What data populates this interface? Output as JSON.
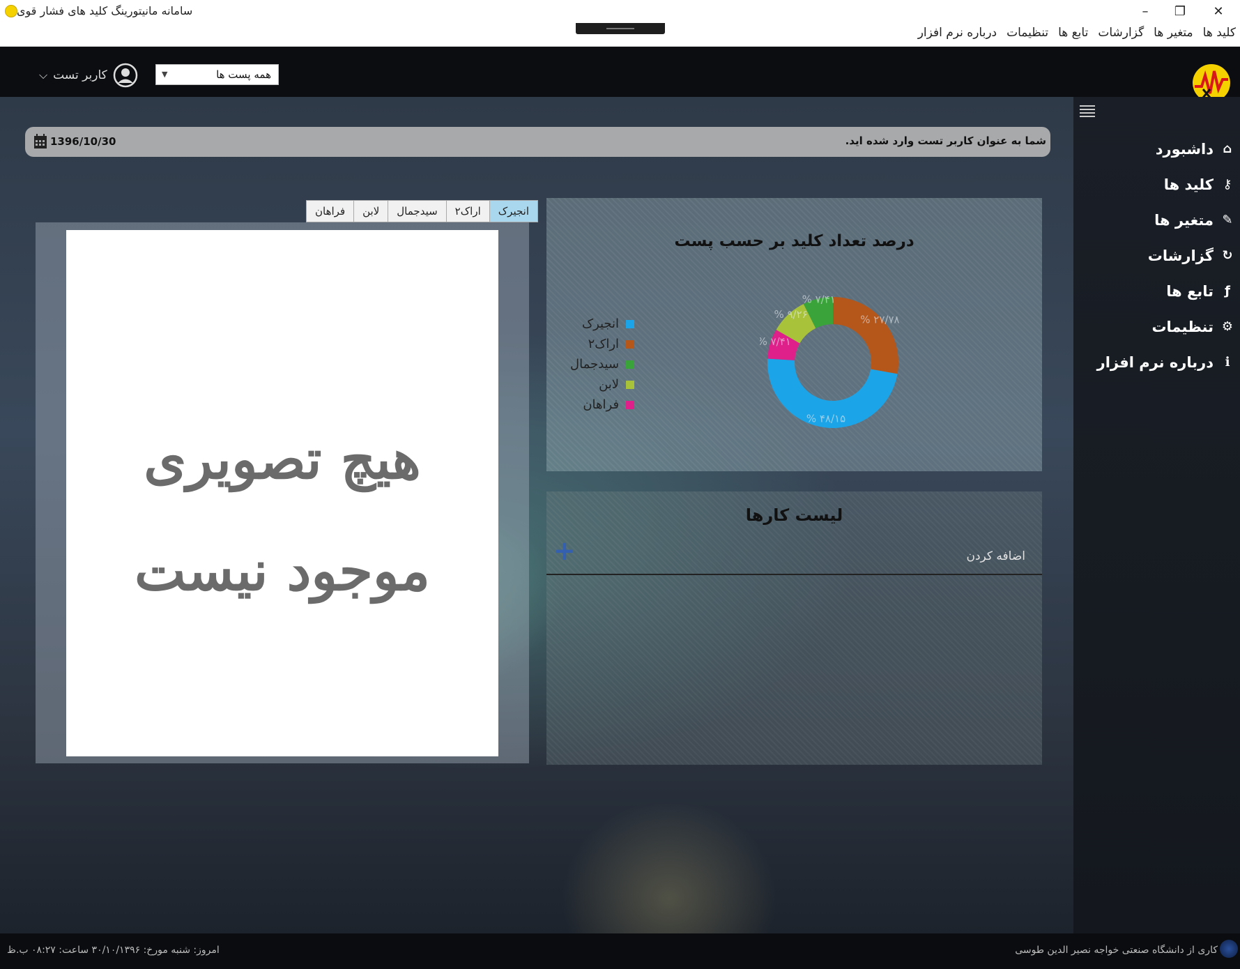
{
  "window": {
    "title": "سامانه مانیتورینگ کلید های فشار قوی",
    "minimize_glyph": "–",
    "maximize_glyph": "❐",
    "close_glyph": "✕"
  },
  "menu": {
    "items": [
      "کلید ها",
      "متغیر ها",
      "گزارشات",
      "تابع ها",
      "تنظیمات",
      "درباره نرم افزار"
    ]
  },
  "header": {
    "station_select": {
      "selected": "همه پست ها"
    },
    "user": {
      "name": "کاربر تست"
    }
  },
  "sidebar": {
    "items": [
      {
        "label": "داشبورد",
        "icon": "home-icon",
        "glyph": "⌂"
      },
      {
        "label": "کلید ها",
        "icon": "key-icon",
        "glyph": "⚷"
      },
      {
        "label": "متغیر ها",
        "icon": "variable-icon",
        "glyph": "✎"
      },
      {
        "label": "گزارشات",
        "icon": "report-icon",
        "glyph": "↻"
      },
      {
        "label": "تابع ها",
        "icon": "function-icon",
        "glyph": "ƒ"
      },
      {
        "label": "تنظیمات",
        "icon": "gear-icon",
        "glyph": "⚙"
      },
      {
        "label": "درباره نرم افزار",
        "icon": "info-icon",
        "glyph": "ℹ"
      }
    ]
  },
  "welcome": {
    "message": "شما به عنوان کاربر تست وارد شده اید.",
    "date": "1396/10/30"
  },
  "image_panel": {
    "tabs": [
      "انجیرک",
      "اراک۲",
      "سیدجمال",
      "لابن",
      "فراهان"
    ],
    "active_tab": 0,
    "no_image_line1": "هیچ تصویری",
    "no_image_line2": "موجود نیست"
  },
  "chart_data": {
    "type": "pie",
    "title": "درصد تعداد کلید بر حسب پست",
    "donut": true,
    "legend_position": "left",
    "series": [
      {
        "name": "انجیرک",
        "value": 48.15,
        "label": "% ۴۸/۱۵",
        "color": "#1ca4e8"
      },
      {
        "name": "اراک۲",
        "value": 27.78,
        "label": "% ۲۷/۷۸",
        "color": "#b5561a"
      },
      {
        "name": "سیدجمال",
        "value": 7.41,
        "label": "% ۷/۴۱",
        "color": "#3aa43a"
      },
      {
        "name": "لابن",
        "value": 9.26,
        "label": "% ۹/۲۶",
        "color": "#a8c23a"
      },
      {
        "name": "فراهان",
        "value": 7.41,
        "label": "% ۷/۴۱",
        "color": "#e0208a"
      }
    ]
  },
  "tasks": {
    "title": "لیست کارها",
    "add_placeholder": "اضافه کردن",
    "add_glyph": "+"
  },
  "status": {
    "left": "امروز: شنبه مورخ: ۳۰/۱۰/۱۳۹۶ ساعت: ۰۸:۲۷ ب.ظ",
    "right": "کاری از دانشگاه صنعتی خواجه نصیر الدین طوسی"
  },
  "colors": {
    "accent_tab": "#a9d7ee",
    "header_bg": "#0b0d10",
    "add_button": "#3560b0"
  }
}
